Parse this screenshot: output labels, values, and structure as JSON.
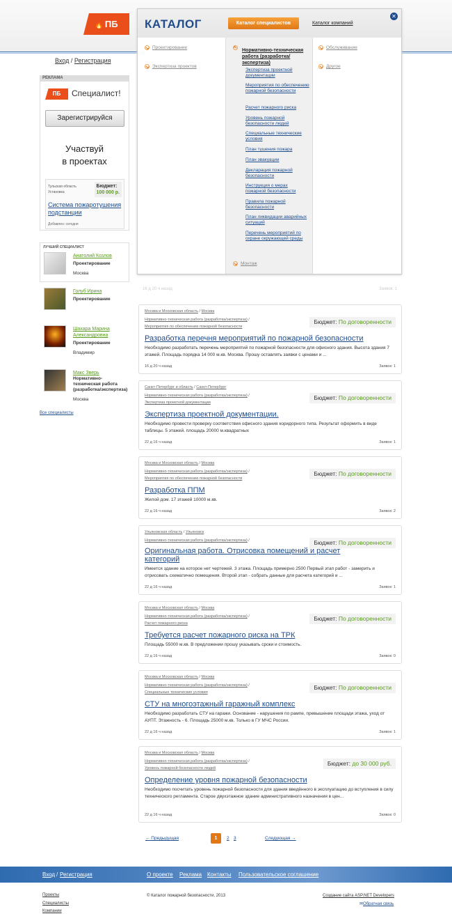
{
  "logo": "ПБ",
  "auth": {
    "login": "Вход",
    "sep": "/",
    "register": "Регистрация"
  },
  "ad": {
    "label": "РЕКЛАМА",
    "logo": "ПБ",
    "spec": "Специалист!",
    "button": "Зарегистрируйся",
    "line1": "Участвуй",
    "line2": "в проектах",
    "region": "Тульская область",
    "city": "Установка",
    "budget_label": "Бюджет:",
    "budget": "100 000 р.",
    "title": "Система пожаротушения подстанции",
    "added": "Добавлен: сегодня"
  },
  "best": {
    "label": "ЛУЧШИЙ СПЕЦИАЛИСТ",
    "all": "Все специалисты",
    "items": [
      {
        "name": "Анатолий Козлов",
        "cat": "Проектирование",
        "city": "Москва"
      },
      {
        "name": "Голуб Ирина",
        "cat": "Проектирование",
        "city": ""
      },
      {
        "name": "Шахара Марина Александровна",
        "cat": "Проектирование",
        "city": "Владимир"
      },
      {
        "name": "Макс Зверь",
        "cat": "Нормативно-техническая работа (разработка/экспертиза)",
        "city": "Москва"
      }
    ]
  },
  "catalog": {
    "title": "КАТАЛОГ",
    "active_tab": "Каталог специалистов",
    "other_tab": "Каталог компаний",
    "col1": [
      "Проектирование",
      "Экспертиза проектов"
    ],
    "col2_head": "Нормативно-техническая работа (разработка/экспертиза)",
    "col2": [
      "Экспертиза проектной документации",
      "Мероприятия по обеспечению пожарной безопасности",
      "Расчет пожарного риска",
      "Уровень пожарной безопасности людей",
      "Специальные технические условия",
      "План тушения пожара",
      "План эвакуации",
      "Декларация пожарной безопасности",
      "Инструкция о мерах пожарной безопасности",
      "Правила пожарной безопасности",
      "План ликвидации аварийных ситуаций",
      "Перечень мероприятий по охране окружающей среды"
    ],
    "col2_bottom": "Монтаж",
    "col3": [
      "Обслуживание",
      "Другое"
    ]
  },
  "filter": {
    "left": "16 д 20 ч назад",
    "right": "Заявок: 1"
  },
  "budget_label": "Бюджет:",
  "projects": [
    {
      "loc": [
        "Москва и Московская область",
        "Москва"
      ],
      "bc": [
        "Нормативно-техническая работа (разработка/экспертиза)",
        "Мероприятия по обеспечению пожарной безопасности"
      ],
      "budget": "По договоренности",
      "title": "Разработка перечня мероприятий по пожарной безопасности",
      "desc": "Необходимо разработать перечень мероприятий по пожарной безопасности для офисного здания. Высота здания 7 этажей. Площадь порядка 14 000 м.кв. Москва. Прошу оставлять заявки с ценами и ...",
      "time": "16 д 20 ч назад",
      "bids": "Заявок: 1"
    },
    {
      "loc": [
        "Санкт-Петербург и область",
        "Санкт-Петербург"
      ],
      "bc": [
        "Нормативно-техническая работа (разработка/экспертиза)",
        "Экспертиза проектной документации"
      ],
      "budget": "По договоренности",
      "title": "Экспертиза проектной документации.",
      "desc": "Необходимо провести проверку соответствия офисного здания коридорного типа. Результат оформить в виде таблицы. 5 этажей. площадь 20000 м.квадратных",
      "time": "22 д 16 ч назад",
      "bids": "Заявок: 1"
    },
    {
      "loc": [
        "Москва и Московская область",
        "Москва"
      ],
      "bc": [
        "Нормативно-техническая работа (разработка/экспертиза)",
        "Мероприятия по обеспечению пожарной безопасности"
      ],
      "budget": "По договоренности",
      "title": "Разработка ППМ",
      "desc": "Жилой дом. 17 этажей 10000 м.кв.",
      "time": "22 д 16 ч назад",
      "bids": "Заявок: 2"
    },
    {
      "loc": [
        "Ульяновская область",
        "Ульяновск"
      ],
      "bc": [
        "Нормативно-техническая работа (разработка/экспертиза)"
      ],
      "budget": "По договоренности",
      "title": "Оригинальная работа. Отрисовка помещений и расчет категорий",
      "desc": "Имеется здание на которое нет чертежей. 3 этажа. Площадь примерно 2500 Первый этап работ - замерить и отрисовать схематично помещения. Второй этап - собрать данные для расчета категорий и ...",
      "time": "22 д 16 ч назад",
      "bids": "Заявок: 1"
    },
    {
      "loc": [
        "Москва и Московская область",
        "Москва"
      ],
      "bc": [
        "Нормативно-техническая работа (разработка/экспертиза)",
        "Расчет пожарного риска"
      ],
      "budget": "По договоренности",
      "title": "Требуется расчет пожарного риска на ТРК",
      "desc": "Площадь 55000 м.кв. В предложении прошу указывать сроки и стоимость.",
      "time": "22 д 16 ч назад",
      "bids": "Заявок: 0"
    },
    {
      "loc": [
        "Москва и Московская область",
        "Москва"
      ],
      "bc": [
        "Нормативно-техническая работа (разработка/экспертиза)",
        "Специальные технические условия"
      ],
      "budget": "По договоренности",
      "title": "СТУ на многоэтажный гаражный комплекс",
      "desc": "Необходимо разработать СТУ на гаражи. Основание - нарушения по рампе, превышение площади этажа, уход от АУПТ. Этажность - 6. Площадь 25000 м.кв. Только в ГУ МЧС России.",
      "time": "22 д 16 ч назад",
      "bids": "Заявок: 1"
    },
    {
      "loc": [
        "Москва и Московская область",
        "Москва"
      ],
      "bc": [
        "Нормативно-техническая работа (разработка/экспертиза)",
        "Уровень пожарной безопасности людей"
      ],
      "budget": "до 30 000 руб.",
      "title": "Определение уровня пожарной безопасности",
      "desc": "Необходимо посчитать уровень пожарной безопасности для здания введённого в эксплуатацию до вступления в силу технического регламента. Старое двухэтажное здание административного назначения в цен...",
      "time": "22 д 16 ч назад",
      "bids": "Заявок: 0"
    }
  ],
  "pagination": {
    "prev": "← Предыдущая",
    "current": "1",
    "p2": "2",
    "p3": "3",
    "next": "Следующая →"
  },
  "footer": {
    "login": "Вход",
    "register": "Регистрация",
    "about": "О проекте",
    "ads": "Реклама",
    "contacts": "Контакты",
    "agreement": "Пользовательское соглашение",
    "bottom": [
      "Проекты",
      "Специалисты",
      "Компании"
    ],
    "copyright": "© Каталог пожарной безопасности, 2013",
    "dev": "Создание сайта ASP.NET Developers",
    "feedback": "Обратная связь"
  }
}
